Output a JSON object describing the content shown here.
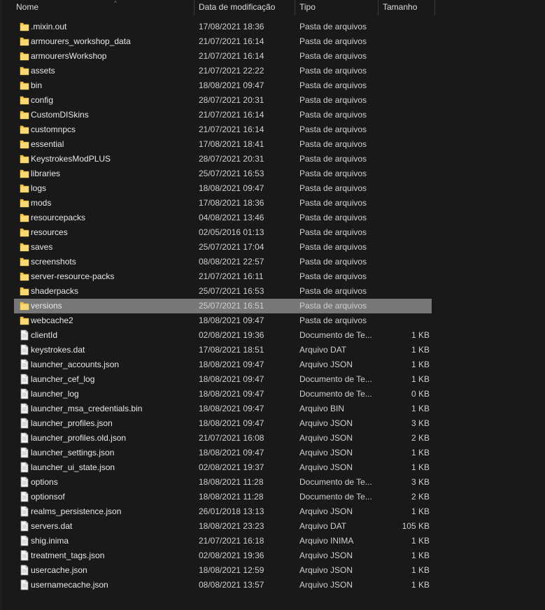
{
  "columns": {
    "name": "Nome",
    "date": "Data de modificação",
    "type": "Tipo",
    "size": "Tamanho"
  },
  "colors": {
    "background": "#191919",
    "selected_row": "#777777",
    "folder": "#f2c94c",
    "file": "#f4f4f4"
  },
  "files": [
    {
      "name": ".mixin.out",
      "date": "17/08/2021 18:36",
      "type": "Pasta de arquivos",
      "size": "",
      "icon": "folder-icon"
    },
    {
      "name": "armourers_workshop_data",
      "date": "21/07/2021 16:14",
      "type": "Pasta de arquivos",
      "size": "",
      "icon": "folder-icon"
    },
    {
      "name": "armourersWorkshop",
      "date": "21/07/2021 16:14",
      "type": "Pasta de arquivos",
      "size": "",
      "icon": "folder-icon"
    },
    {
      "name": "assets",
      "date": "21/07/2021 22:22",
      "type": "Pasta de arquivos",
      "size": "",
      "icon": "folder-icon"
    },
    {
      "name": "bin",
      "date": "18/08/2021 09:47",
      "type": "Pasta de arquivos",
      "size": "",
      "icon": "folder-icon"
    },
    {
      "name": "config",
      "date": "28/07/2021 20:31",
      "type": "Pasta de arquivos",
      "size": "",
      "icon": "folder-icon"
    },
    {
      "name": "CustomDISkins",
      "date": "21/07/2021 16:14",
      "type": "Pasta de arquivos",
      "size": "",
      "icon": "folder-icon"
    },
    {
      "name": "customnpcs",
      "date": "21/07/2021 16:14",
      "type": "Pasta de arquivos",
      "size": "",
      "icon": "folder-icon"
    },
    {
      "name": "essential",
      "date": "17/08/2021 18:41",
      "type": "Pasta de arquivos",
      "size": "",
      "icon": "folder-icon"
    },
    {
      "name": "KeystrokesModPLUS",
      "date": "28/07/2021 20:31",
      "type": "Pasta de arquivos",
      "size": "",
      "icon": "folder-icon"
    },
    {
      "name": "libraries",
      "date": "25/07/2021 16:53",
      "type": "Pasta de arquivos",
      "size": "",
      "icon": "folder-icon"
    },
    {
      "name": "logs",
      "date": "18/08/2021 09:47",
      "type": "Pasta de arquivos",
      "size": "",
      "icon": "folder-icon"
    },
    {
      "name": "mods",
      "date": "17/08/2021 18:36",
      "type": "Pasta de arquivos",
      "size": "",
      "icon": "folder-icon"
    },
    {
      "name": "resourcepacks",
      "date": "04/08/2021 13:46",
      "type": "Pasta de arquivos",
      "size": "",
      "icon": "folder-icon"
    },
    {
      "name": "resources",
      "date": "02/05/2016 01:13",
      "type": "Pasta de arquivos",
      "size": "",
      "icon": "folder-icon"
    },
    {
      "name": "saves",
      "date": "25/07/2021 17:04",
      "type": "Pasta de arquivos",
      "size": "",
      "icon": "folder-icon"
    },
    {
      "name": "screenshots",
      "date": "08/08/2021 22:57",
      "type": "Pasta de arquivos",
      "size": "",
      "icon": "folder-icon"
    },
    {
      "name": "server-resource-packs",
      "date": "21/07/2021 16:11",
      "type": "Pasta de arquivos",
      "size": "",
      "icon": "folder-icon"
    },
    {
      "name": "shaderpacks",
      "date": "25/07/2021 16:53",
      "type": "Pasta de arquivos",
      "size": "",
      "icon": "folder-icon"
    },
    {
      "name": "versions",
      "date": "25/07/2021 16:51",
      "type": "Pasta de arquivos",
      "size": "",
      "icon": "folder-icon",
      "selected": true
    },
    {
      "name": "webcache2",
      "date": "18/08/2021 09:47",
      "type": "Pasta de arquivos",
      "size": "",
      "icon": "folder-icon"
    },
    {
      "name": "clientId",
      "date": "02/08/2021 19:36",
      "type": "Documento de Te...",
      "size": "1 KB",
      "icon": "file-icon"
    },
    {
      "name": "keystrokes.dat",
      "date": "17/08/2021 18:51",
      "type": "Arquivo DAT",
      "size": "1 KB",
      "icon": "file-icon"
    },
    {
      "name": "launcher_accounts.json",
      "date": "18/08/2021 09:47",
      "type": "Arquivo JSON",
      "size": "1 KB",
      "icon": "file-icon"
    },
    {
      "name": "launcher_cef_log",
      "date": "18/08/2021 09:47",
      "type": "Documento de Te...",
      "size": "1 KB",
      "icon": "file-icon"
    },
    {
      "name": "launcher_log",
      "date": "18/08/2021 09:47",
      "type": "Documento de Te...",
      "size": "0 KB",
      "icon": "file-icon"
    },
    {
      "name": "launcher_msa_credentials.bin",
      "date": "18/08/2021 09:47",
      "type": "Arquivo BIN",
      "size": "1 KB",
      "icon": "file-icon"
    },
    {
      "name": "launcher_profiles.json",
      "date": "18/08/2021 09:47",
      "type": "Arquivo JSON",
      "size": "3 KB",
      "icon": "file-icon"
    },
    {
      "name": "launcher_profiles.old.json",
      "date": "21/07/2021 16:08",
      "type": "Arquivo JSON",
      "size": "2 KB",
      "icon": "file-icon"
    },
    {
      "name": "launcher_settings.json",
      "date": "18/08/2021 09:47",
      "type": "Arquivo JSON",
      "size": "1 KB",
      "icon": "file-icon"
    },
    {
      "name": "launcher_ui_state.json",
      "date": "02/08/2021 19:37",
      "type": "Arquivo JSON",
      "size": "1 KB",
      "icon": "file-icon"
    },
    {
      "name": "options",
      "date": "18/08/2021 11:28",
      "type": "Documento de Te...",
      "size": "3 KB",
      "icon": "file-icon"
    },
    {
      "name": "optionsof",
      "date": "18/08/2021 11:28",
      "type": "Documento de Te...",
      "size": "2 KB",
      "icon": "file-icon"
    },
    {
      "name": "realms_persistence.json",
      "date": "26/01/2018 13:13",
      "type": "Arquivo JSON",
      "size": "1 KB",
      "icon": "file-icon"
    },
    {
      "name": "servers.dat",
      "date": "18/08/2021 23:23",
      "type": "Arquivo DAT",
      "size": "105 KB",
      "icon": "file-icon"
    },
    {
      "name": "shig.inima",
      "date": "21/07/2021 16:18",
      "type": "Arquivo INIMA",
      "size": "1 KB",
      "icon": "file-icon"
    },
    {
      "name": "treatment_tags.json",
      "date": "02/08/2021 19:36",
      "type": "Arquivo JSON",
      "size": "1 KB",
      "icon": "file-icon"
    },
    {
      "name": "usercache.json",
      "date": "18/08/2021 12:59",
      "type": "Arquivo JSON",
      "size": "1 KB",
      "icon": "file-icon"
    },
    {
      "name": "usernamecache.json",
      "date": "08/08/2021 13:57",
      "type": "Arquivo JSON",
      "size": "1 KB",
      "icon": "file-icon"
    }
  ]
}
